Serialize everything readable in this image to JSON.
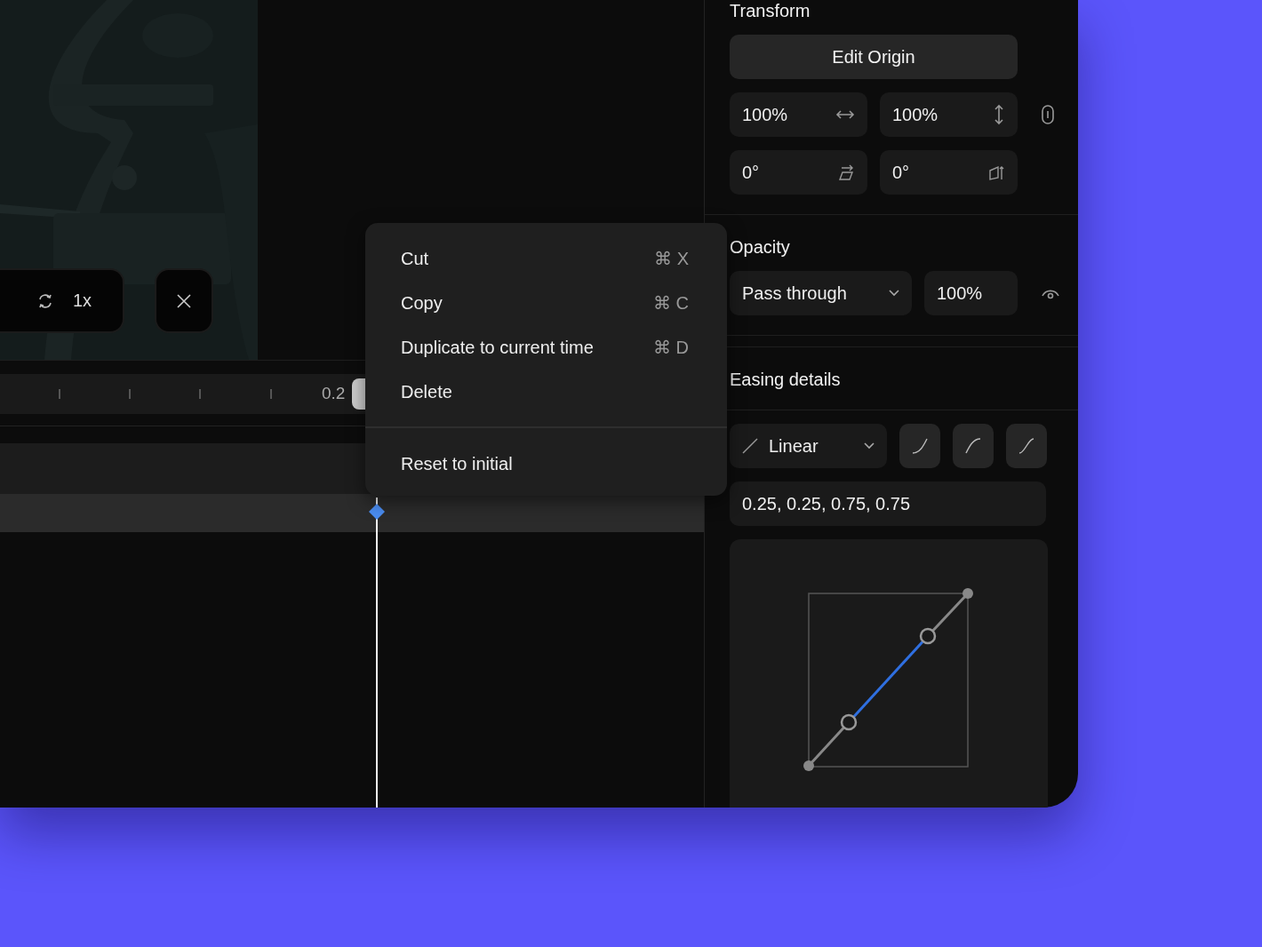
{
  "preview": {
    "speed": "1x"
  },
  "timeline": {
    "ruler_label": "0.2",
    "tracks": [
      {
        "selected": false
      },
      {
        "selected": true
      }
    ]
  },
  "context_menu": {
    "groups": [
      [
        {
          "label": "Cut",
          "shortcut": "⌘ X"
        },
        {
          "label": "Copy",
          "shortcut": "⌘ C"
        },
        {
          "label": "Duplicate to current time",
          "shortcut": "⌘ D"
        },
        {
          "label": "Delete"
        }
      ],
      [
        {
          "label": "Reset to initial"
        }
      ]
    ]
  },
  "inspector": {
    "transform": {
      "title": "Transform",
      "edit_origin": "Edit Origin",
      "fields": [
        {
          "value": "100%",
          "kind": "width"
        },
        {
          "value": "100%",
          "kind": "height"
        },
        {
          "value": "0°",
          "kind": "skew"
        },
        {
          "value": "0°",
          "kind": "rotate"
        }
      ]
    },
    "opacity": {
      "title": "Opacity",
      "blend_mode": "Pass through",
      "value": "100%"
    },
    "easing": {
      "title": "Easing details",
      "preset": "Linear",
      "bezier": "0.25, 0.25, 0.75, 0.75"
    }
  }
}
